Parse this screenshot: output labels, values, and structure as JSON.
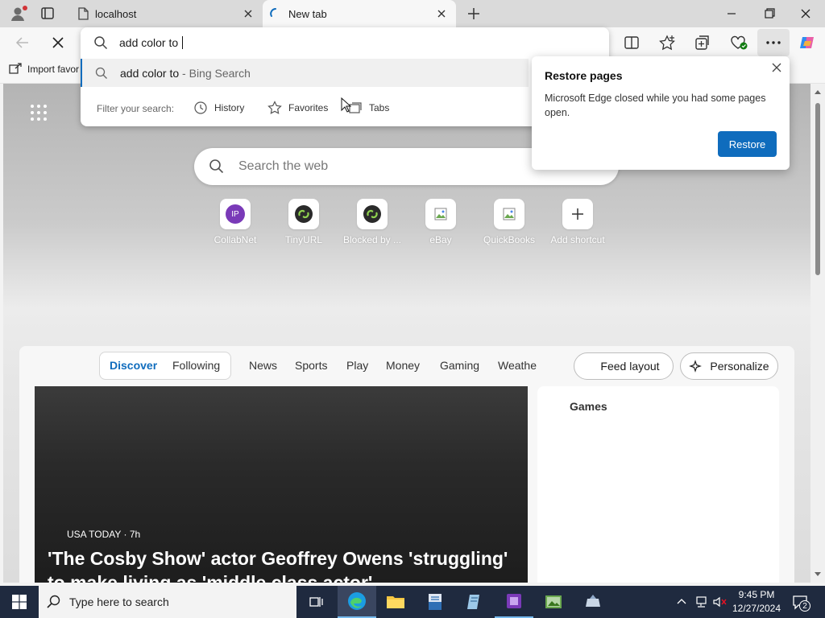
{
  "browser": {
    "tabs": [
      {
        "label": "localhost",
        "active": false
      },
      {
        "label": "New tab",
        "active": true
      }
    ],
    "address_value": "add color to ",
    "favorites_bar": {
      "import_label": "Import favor"
    }
  },
  "omnibox": {
    "suggestion_query": "add color to",
    "suggestion_suffix": " - Bing Search",
    "filter_label": "Filter your search:",
    "filters": [
      "History",
      "Favorites",
      "Tabs"
    ]
  },
  "page": {
    "search_placeholder": "Search the web",
    "shortcuts": [
      {
        "label": "CollabNet",
        "icon": "ip-avatar-icon",
        "avatar_text": "IP",
        "avatar_color": "#7a3ab8"
      },
      {
        "label": "TinyURL",
        "icon": "tinyurl-icon"
      },
      {
        "label": "Blocked by ...",
        "icon": "tinyurl-icon"
      },
      {
        "label": "eBay",
        "icon": "broken-image-icon"
      },
      {
        "label": "QuickBooks",
        "icon": "broken-image-icon"
      },
      {
        "label": "Add shortcut",
        "icon": "plus-icon"
      }
    ],
    "feed_tabs": [
      "Discover",
      "Following"
    ],
    "feed_nav": [
      "News",
      "Sports",
      "Play",
      "Money",
      "Gaming",
      "Weathe"
    ],
    "feed_layout_label": "Feed layout",
    "personalize_label": "Personalize",
    "hero": {
      "source": "USA TODAY",
      "age": "· 7h",
      "headline_line1": "'The Cosby Show' actor Geoffrey Owens 'struggling'",
      "headline_line2": "to make living as 'middle class actor'"
    },
    "games_title": "Games"
  },
  "popup": {
    "title": "Restore pages",
    "body": "Microsoft Edge closed while you had some pages open.",
    "button_label": "Restore"
  },
  "taskbar": {
    "search_placeholder": "Type here to search",
    "time": "9:45 PM",
    "date": "12/27/2024",
    "notification_count": "2"
  },
  "colors": {
    "accent": "#0f6cbd",
    "taskbar": "#1f2a3f"
  }
}
